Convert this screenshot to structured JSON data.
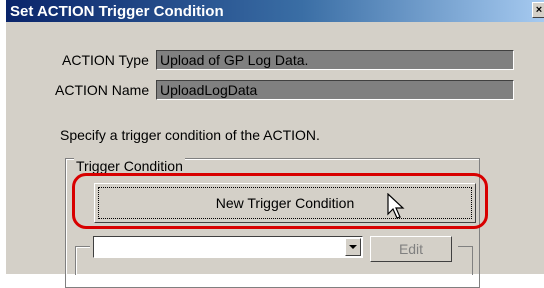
{
  "dialog": {
    "title": "Set ACTION Trigger Condition",
    "close_label": "×"
  },
  "action_type": {
    "label": "ACTION Type",
    "value": "Upload of GP Log Data."
  },
  "action_name": {
    "label": "ACTION Name",
    "value": "UploadLogData"
  },
  "instruction": "Specify a trigger condition of the ACTION.",
  "trigger_group": {
    "title": "Trigger Condition",
    "new_button": "New Trigger Condition",
    "combo_value": "",
    "edit_button": "Edit"
  },
  "colors": {
    "highlight": "#d80000",
    "titlebar": "#0a246a"
  },
  "icons": {
    "cursor": "arrow-pointer-icon",
    "dropdown": "chevron-down-icon"
  }
}
